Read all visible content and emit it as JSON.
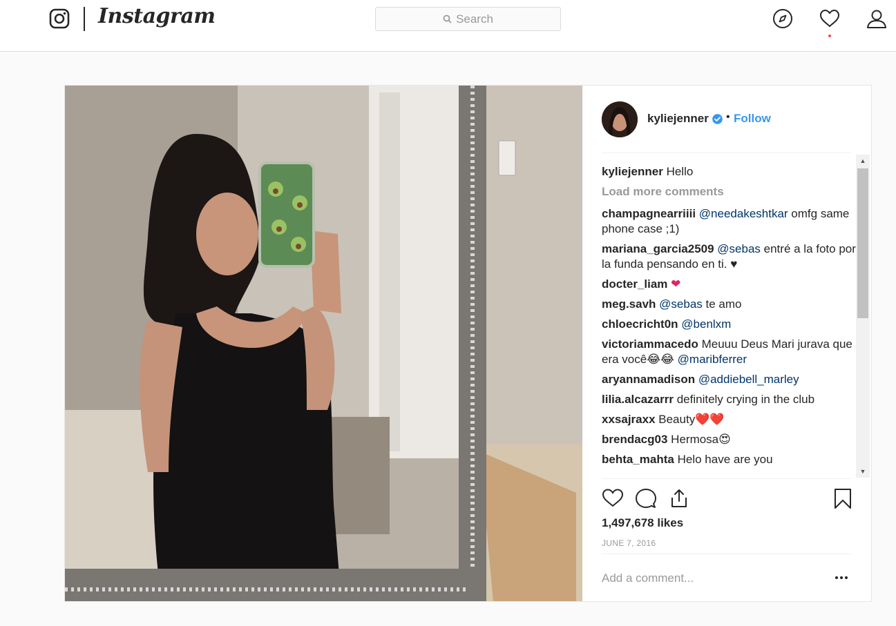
{
  "nav": {
    "wordmark": "Instagram",
    "search_placeholder": "Search",
    "icons": [
      "instagram-glyph-icon",
      "compass-icon",
      "heart-icon",
      "profile-icon"
    ],
    "notification_dot_color": "#ed4956"
  },
  "post": {
    "username": "kyliejenner",
    "verified": true,
    "separator": "•",
    "follow_label": "Follow",
    "caption": {
      "user": "kyliejenner",
      "text": "Hello"
    },
    "load_more_label": "Load more comments",
    "comments": [
      {
        "user": "champagnearriiii",
        "mention": "@needakeshtkar",
        "text": " omfg same phone case ;1)"
      },
      {
        "user": "mariana_garcia2509",
        "mention": "@sebas",
        "text": " entré a la foto por la funda pensando en ti. ♥"
      },
      {
        "user": "docter_liam",
        "mention": "",
        "text": "",
        "emoji": "❤"
      },
      {
        "user": "meg.savh",
        "mention": "@sebas",
        "text": " te amo"
      },
      {
        "user": "chloecricht0n",
        "mention": "@benlxm",
        "text": ""
      },
      {
        "user": "victoriammacedo",
        "prefix": "Meuuu Deus Mari jurava que era você😂😂  ",
        "mention": "@maribferrer",
        "text": ""
      },
      {
        "user": "aryannamadison",
        "mention": "@addiebell_marley",
        "text": ""
      },
      {
        "user": "lilia.alcazarrr",
        "mention": "",
        "text": "definitely crying in the club"
      },
      {
        "user": "xxsajraxx",
        "mention": "",
        "text": "Beauty❤️❤️"
      },
      {
        "user": "brendacg03",
        "mention": "",
        "text": "Hermosa😍"
      },
      {
        "user": "behta_mahta",
        "mention": "",
        "text": "Helo have are you"
      }
    ],
    "likes": "1,497,678 likes",
    "date": "JUNE 7, 2016",
    "add_comment_placeholder": "Add a comment...",
    "accent_color": "#3897f0",
    "mention_color": "#003569"
  }
}
